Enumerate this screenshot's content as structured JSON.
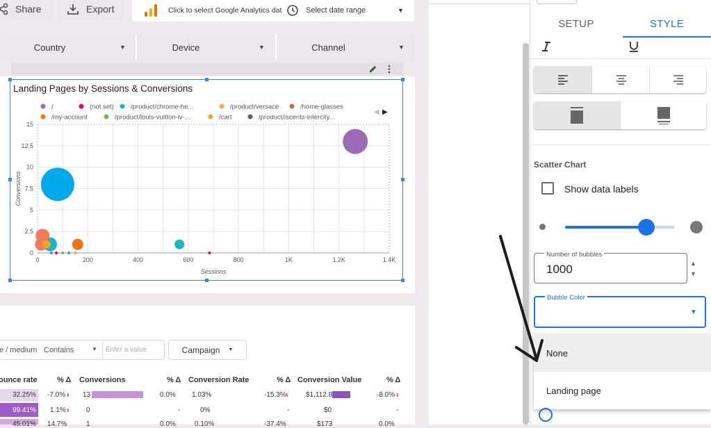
{
  "toolbar": {
    "share_label": "Share",
    "export_label": "Export",
    "ga_label": "Click to select Google Analytics data",
    "date_label": "Select date range"
  },
  "filters": [
    {
      "label": "Country"
    },
    {
      "label": "Device"
    },
    {
      "label": "Channel"
    }
  ],
  "chart_data": {
    "type": "scatter",
    "title": "Landing Pages by Sessions & Conversions",
    "xlabel": "Sessions",
    "ylabel": "Conversions",
    "xlim": [
      0,
      14000
    ],
    "ylim": [
      0,
      15
    ],
    "x_ticks": [
      "0",
      "200",
      "400",
      "600",
      "800",
      "1K",
      "1.2K",
      "1.4K"
    ],
    "y_ticks": [
      "0",
      "2.5",
      "5",
      "7.5",
      "10",
      "12.5",
      "15"
    ],
    "grid": true,
    "legend_position": "top",
    "legend": [
      {
        "name": "/",
        "color": "#9c6bb8"
      },
      {
        "name": "(not set)",
        "color": "#e8006f"
      },
      {
        "name": "/product/chrome-he...",
        "color": "#14b8c6"
      },
      {
        "name": "/product/versace",
        "color": "#f3a86a"
      },
      {
        "name": "/home-glasses",
        "color": "#c8664e"
      },
      {
        "name": "/my-account",
        "color": "#f07314"
      },
      {
        "name": "/product/louis-vuitton-lv-...",
        "color": "#7ab648"
      },
      {
        "name": "/cart",
        "color": "#f2a51e"
      },
      {
        "name": "/product/iscents-intercity...",
        "color": "#5f6368"
      }
    ],
    "points": [
      {
        "x": 1265,
        "y": 13,
        "r": 18,
        "color": "#9c6bb8"
      },
      {
        "x": 80,
        "y": 8,
        "r": 24,
        "color": "#00a8ec"
      },
      {
        "x": 565,
        "y": 1,
        "r": 7,
        "color": "#14b8c6"
      },
      {
        "x": 160,
        "y": 1,
        "r": 8,
        "color": "#f07314"
      },
      {
        "x": 50,
        "y": 1,
        "r": 10,
        "color": "#14b8c6"
      },
      {
        "x": 20,
        "y": 2,
        "r": 10,
        "color": "#f07a5a"
      },
      {
        "x": 15,
        "y": 1,
        "r": 9,
        "color": "#f07a5a"
      },
      {
        "x": 35,
        "y": 1,
        "r": 6,
        "color": "#f2a51e"
      },
      {
        "x": 55,
        "y": 0,
        "r": 2,
        "color": "#9c6bb8"
      },
      {
        "x": 75,
        "y": 0,
        "r": 2,
        "color": "#e8006f"
      },
      {
        "x": 100,
        "y": 0,
        "r": 2,
        "color": "#7ab648"
      },
      {
        "x": 125,
        "y": 0,
        "r": 2,
        "color": "#14b8c6"
      },
      {
        "x": 150,
        "y": 0,
        "r": 2,
        "color": "#f3a86a"
      },
      {
        "x": 685,
        "y": 0,
        "r": 2,
        "color": "#e8006f"
      }
    ]
  },
  "table": {
    "filter_field": "e / medium",
    "filter_op": "Contains",
    "filter_placeholder": "Enter a value",
    "campaign_label": "Campaign",
    "headers": [
      "ounce rate",
      "% Δ",
      "Conversions",
      "% Δ",
      "Conversion Rate",
      "% Δ",
      "Conversion Value",
      "% Δ"
    ],
    "rows": [
      [
        "32.25%",
        "-7.0%",
        "13",
        "0.0%",
        "1.03%",
        "-15.3%",
        "$1,112.8",
        "-8.0%"
      ],
      [
        "99.41%",
        "1.1%",
        "0",
        "-",
        "0%",
        "-",
        "$0",
        "-"
      ],
      [
        "45.01%",
        "14.7%",
        "1",
        "0.0%",
        "0.10%",
        "-37.4%",
        "$173",
        "0.0%"
      ]
    ]
  },
  "panel": {
    "tabs": [
      "SETUP",
      "STYLE"
    ],
    "active_tab": "STYLE",
    "section_title": "Scatter Chart",
    "show_labels": "Show data labels",
    "bubble_count_label": "Number of bubbles",
    "bubble_count_value": "1000",
    "bubble_color_label": "Bubble Color",
    "bubble_color_value": "",
    "dropdown_options": [
      "None",
      "Landing page"
    ],
    "slider_value": 0.74,
    "accent": "#1a73e8"
  }
}
